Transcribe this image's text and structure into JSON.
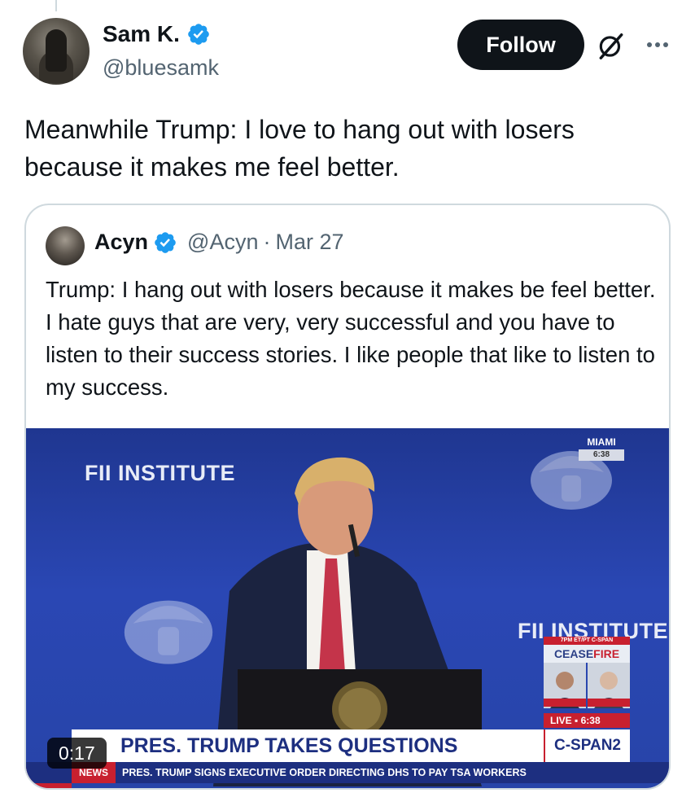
{
  "author": {
    "display_name": "Sam K.",
    "handle": "@bluesamk"
  },
  "actions": {
    "follow_label": "Follow"
  },
  "icons": {
    "verified": "verified-badge-icon",
    "grok": "grok-icon",
    "more": "more-options-icon"
  },
  "colors": {
    "verified_blue": "#1d9bf0",
    "follow_bg": "#0f1419",
    "secondary_text": "#536471"
  },
  "tweet": {
    "text": "Meanwhile Trump: I love to hang out with losers because it makes me feel better."
  },
  "quote": {
    "display_name": "Acyn",
    "handle": "@Acyn",
    "separator": "·",
    "date": "Mar 27",
    "text": "Trump: I hang out with losers because it makes be feel better. I hate guys that are very, very successful and you have to listen to their success stories. I like people that like to listen to my success."
  },
  "video": {
    "duration": "0:17",
    "logo_text": "FII INSTITUTE",
    "location": "MIAMI",
    "location_time": "6:38",
    "cease_top": "7PM ET/PT C-SPAN",
    "cease_a": "CEASE",
    "cease_b": "FIRE",
    "live": "LIVE ▪ 6:38",
    "headline": "PRES. TRUMP TAKES QUESTIONS",
    "network": "C-SPAN2",
    "ticker_tag": "NEWS",
    "ticker": "PRES. TRUMP SIGNS EXECUTIVE ORDER DIRECTING DHS TO PAY TSA WORKERS"
  }
}
